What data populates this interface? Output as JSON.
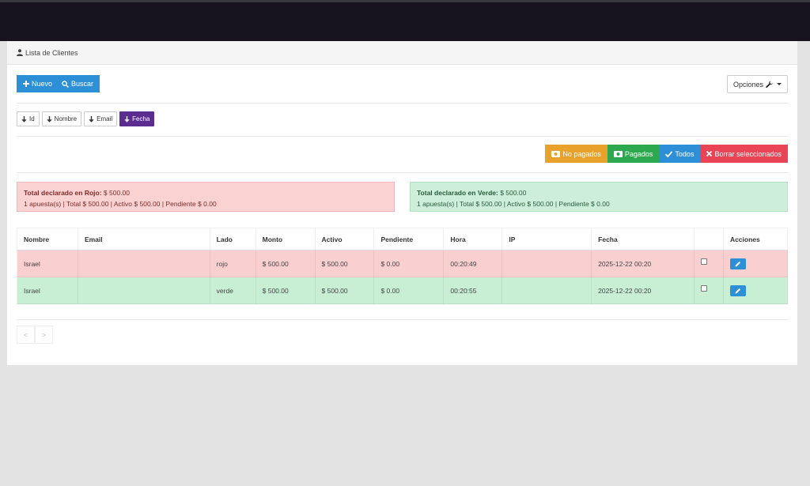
{
  "panel": {
    "title": "Lista de Clientes"
  },
  "toolbar": {
    "new_label": "Nuevo",
    "search_label": "Buscar",
    "options_label": "Opciones"
  },
  "sort": {
    "id": "Id",
    "nombre": "Nombre",
    "email": "Email",
    "fecha": "Fecha"
  },
  "filters": {
    "unpaid": "No pagados",
    "paid": "Pagados",
    "all": "Todos",
    "delete_selected": "Borrar seleccionados"
  },
  "summary": {
    "red": {
      "label": "Total declarado en Rojo:",
      "total": "$ 500.00",
      "details": "1 apuesta(s) | Total $ 500.00 | Activo $ 500.00 | Pendiente $ 0.00"
    },
    "green": {
      "label": "Total declarado en Verde:",
      "total": "$ 500.00",
      "details": "1 apuesta(s) | Total $ 500.00 | Activo $ 500.00 | Pendiente $ 0.00"
    }
  },
  "table": {
    "headers": [
      "Nombre",
      "Email",
      "Lado",
      "Monto",
      "Activo",
      "Pendiente",
      "Hora",
      "IP",
      "Fecha",
      "",
      "Acciones"
    ],
    "rows": [
      {
        "nombre": "Israel",
        "email": "",
        "lado": "rojo",
        "monto": "$ 500.00",
        "activo": "$ 500.00",
        "pendiente": "$ 0.00",
        "hora": "00:20:49",
        "ip": "",
        "fecha": "2025-12-22 00:20"
      },
      {
        "nombre": "Israel",
        "email": "",
        "lado": "verde",
        "monto": "$ 500.00",
        "activo": "$ 500.00",
        "pendiente": "$ 0.00",
        "hora": "00:20:55",
        "ip": "",
        "fecha": "2025-12-22 00:20"
      }
    ]
  },
  "pager": {
    "prev": "<",
    "next": ">"
  },
  "colors": {
    "blue": "#2d8fd5",
    "purple": "#5b2d91",
    "orange": "#e8a12a",
    "green": "#2ea84f",
    "red": "#e94556",
    "row_red": "#f9cfcf",
    "row_green": "#c8efd4"
  },
  "icons": [
    "user-icon",
    "plus-icon",
    "search-icon",
    "wrench-icon",
    "arrow-down-icon",
    "money-icon",
    "check-icon",
    "times-icon",
    "pencil-icon"
  ]
}
